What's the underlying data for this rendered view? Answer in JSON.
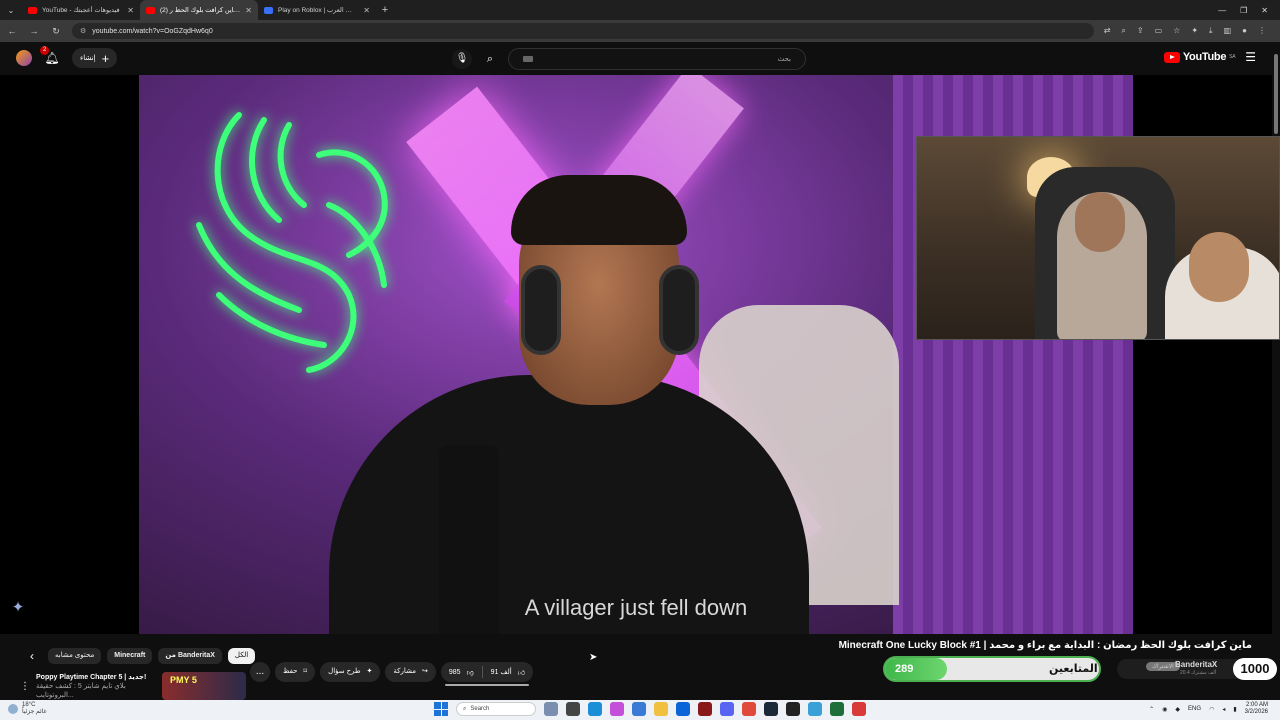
{
  "browser": {
    "tabs": [
      {
        "title": "YouTube - فيديوهات أعجبتك",
        "icon": "youtube-icon",
        "active": false
      },
      {
        "title": "(2) ماين كرافت بلوك الحظ ر...",
        "icon": "youtube-icon",
        "active": true
      },
      {
        "title": "Play on Roblox | مجلس العرب |",
        "icon": "roblox-icon",
        "active": false
      }
    ],
    "url": "youtube.com/watch?v=OoGZqdHw6q0"
  },
  "yt_header": {
    "notification_count": "2",
    "create_label": "إنشاء",
    "search_placeholder": "بحث",
    "logo_text": "YouTube",
    "region": "SA"
  },
  "video": {
    "subtitle": "A villager just fell down",
    "title": "ماين كرافت بلوك الحظ رمضان : البداية مع براء و محمد | Minecraft One Lucky Block #1"
  },
  "overlay": {
    "goal_count": "289",
    "goal_label": "عدد المتابعين",
    "goal_progress": 0.289,
    "channel_name": "BanderitaX",
    "channel_subs": "20.4 ألف مشترك",
    "subscribe_label": "الاشتراك",
    "big_count": "1000"
  },
  "chips": [
    "الكل",
    "من BanderitaX",
    "Minecraft",
    "محتوى مشابه"
  ],
  "actions": {
    "like_count": "91 ألف",
    "dislike_count": "985",
    "share_label": "مشاركة",
    "ask_label": "طرح سؤال",
    "save_label": "حفظ",
    "more_label": "..."
  },
  "recommendation": {
    "title": "Poppy Playtime Chapter 5 | جديد!",
    "subtitle": "بلاي تايم شابتر 5 : كشف حقيقة البروتوتايب...",
    "thumb_label": "PMY 5"
  },
  "taskbar": {
    "weather_temp": "18°C",
    "weather_desc": "غائم جزئياً",
    "search_label": "Search",
    "lang": "ENG",
    "time": "2:00 AM",
    "date": "3/2/2026"
  }
}
